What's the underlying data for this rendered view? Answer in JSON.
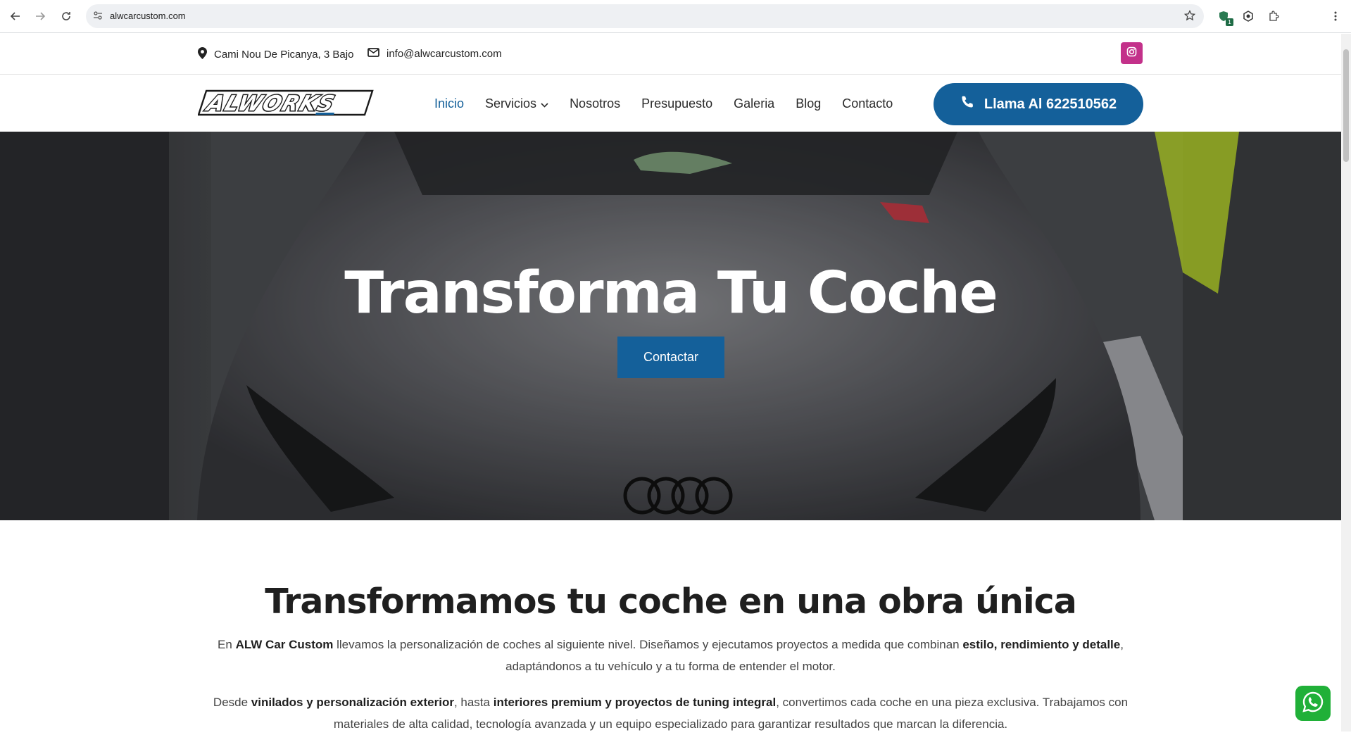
{
  "browser": {
    "url": "alwcarcustom.com",
    "extension_badge": "1"
  },
  "topbar": {
    "address": "Cami Nou De Picanya, 3 Bajo",
    "email": "info@alwcarcustom.com"
  },
  "header": {
    "logo_text": "ALWORKS",
    "menu": [
      {
        "label": "Inicio"
      },
      {
        "label": "Servicios"
      },
      {
        "label": "Nosotros"
      },
      {
        "label": "Presupuesto"
      },
      {
        "label": "Galeria"
      },
      {
        "label": "Blog"
      },
      {
        "label": "Contacto"
      }
    ],
    "call_label": "Llama Al 622510562"
  },
  "hero": {
    "title": "Transforma Tu Coche",
    "cta": "Contactar"
  },
  "about": {
    "heading": "Transformamos tu coche en una obra única",
    "p1": {
      "a": "En ",
      "b": "ALW Car Custom",
      "c": " llevamos la personalización de coches al siguiente nivel. Diseñamos y ejecutamos proyectos a medida que combinan ",
      "d": "estilo, rendimiento y detalle",
      "e": ", adaptándonos a tu vehículo y a tu forma de entender el motor."
    },
    "p2": {
      "a": "Desde ",
      "b": "vinilados y personalización exterior",
      "c": ", hasta ",
      "d": "interiores premium y proyectos de tuning integral",
      "e": ", convertimos cada coche en una pieza exclusiva. Trabajamos con materiales de alta calidad, tecnología avanzada y un equipo especializado para garantizar resultados que marcan la diferencia."
    }
  },
  "colors": {
    "brand_blue": "#14609a",
    "instagram": "#c3318a",
    "whatsapp": "#20b038"
  }
}
